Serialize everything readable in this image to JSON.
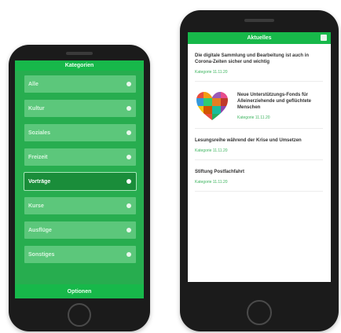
{
  "left_screen": {
    "header_title": "Kategorien",
    "categories": [
      {
        "label": "Alle"
      },
      {
        "label": "Kultur"
      },
      {
        "label": "Soziales"
      },
      {
        "label": "Freizeit"
      },
      {
        "label": "Vorträge"
      },
      {
        "label": "Kurse"
      },
      {
        "label": "Ausflüge"
      },
      {
        "label": "Sonstiges"
      }
    ],
    "selected_index": 4,
    "footer_label": "Optionen"
  },
  "right_screen": {
    "header_title": "Aktuelles",
    "header_icon": "menu-square-icon",
    "news": [
      {
        "title": "Die digitale Sammlung und Bearbeitung ist auch in Corona-Zeiten sicher und wichtig",
        "meta": "Kategorie 11.11.20"
      },
      {
        "title": "Neue Unterstützungs-Fonds für Alleinerziehende und geflüchtete Menschen",
        "meta": "Kategorie 11.11.20",
        "image_icon": "heart-mosaic-icon"
      },
      {
        "title": "Lesungsreihe während der Krise und Umsetzen",
        "meta": "Kategorie 11.11.20"
      },
      {
        "title": "Stiftung Postfachfahrt",
        "meta": "Kategorie 11.11.20"
      }
    ]
  },
  "colors": {
    "brand_green": "#17b84a",
    "list_bg_green": "#27ad4f",
    "item_green": "#5cc77b",
    "selected_green": "#1a8d3a",
    "phone_body": "#1b1b1b"
  }
}
